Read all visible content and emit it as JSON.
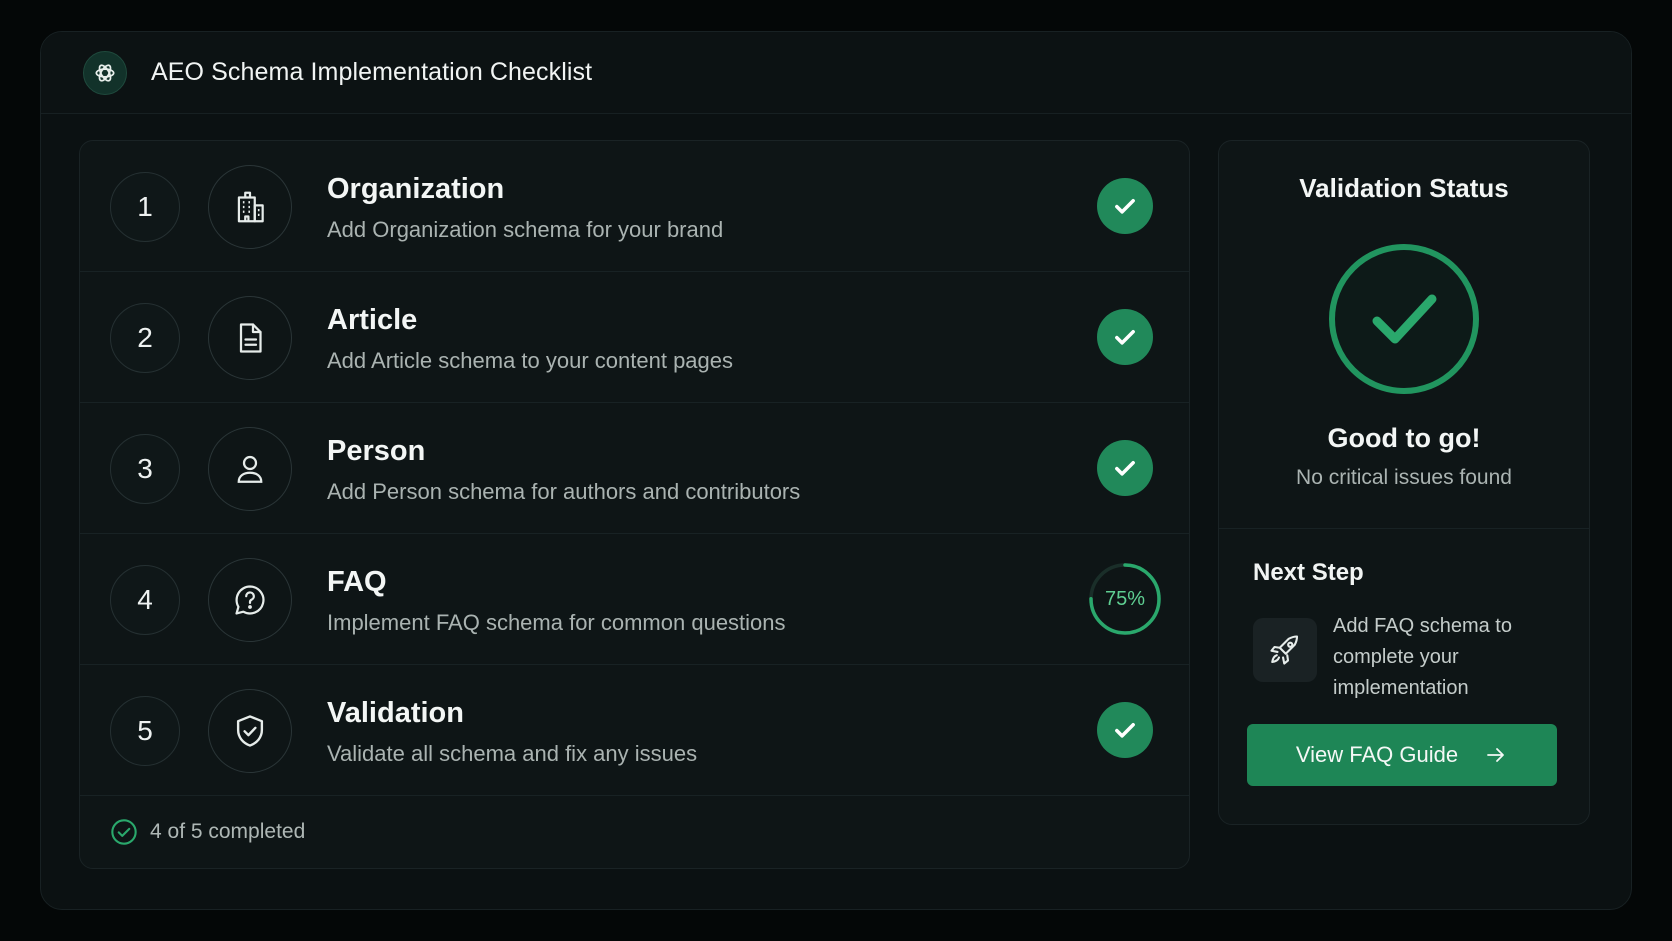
{
  "app": {
    "title": "AEO Schema Implementation Checklist",
    "logo_icon": "openai-logo-icon"
  },
  "checklist": {
    "items": [
      {
        "number": "1",
        "title": "Organization",
        "description": "Add Organization schema for your brand",
        "icon": "building-icon",
        "status": "complete"
      },
      {
        "number": "2",
        "title": "Article",
        "description": "Add Article schema to your content pages",
        "icon": "document-icon",
        "status": "complete"
      },
      {
        "number": "3",
        "title": "Person",
        "description": "Add Person schema for authors and contributors",
        "icon": "person-icon",
        "status": "complete"
      },
      {
        "number": "4",
        "title": "FAQ",
        "description": "Implement FAQ schema for common questions",
        "icon": "question-bubble-icon",
        "status": "in-progress",
        "progress_label": "75%",
        "progress": 0.75
      },
      {
        "number": "5",
        "title": "Validation",
        "description": "Validate all schema and fix any issues",
        "icon": "shield-check-icon",
        "status": "complete"
      }
    ],
    "footer_text": "4 of 5 completed"
  },
  "validation": {
    "title": "Validation Status",
    "status_title": "Good to go!",
    "status_subtitle": "No critical issues found"
  },
  "next_step": {
    "title": "Next Step",
    "description": "Add FAQ schema to complete your implementation",
    "icon": "rocket-icon",
    "button_label": "View FAQ Guide"
  },
  "colors": {
    "accent": "#21895a",
    "accent_light": "#5fcf92",
    "background": "#0b1112"
  }
}
